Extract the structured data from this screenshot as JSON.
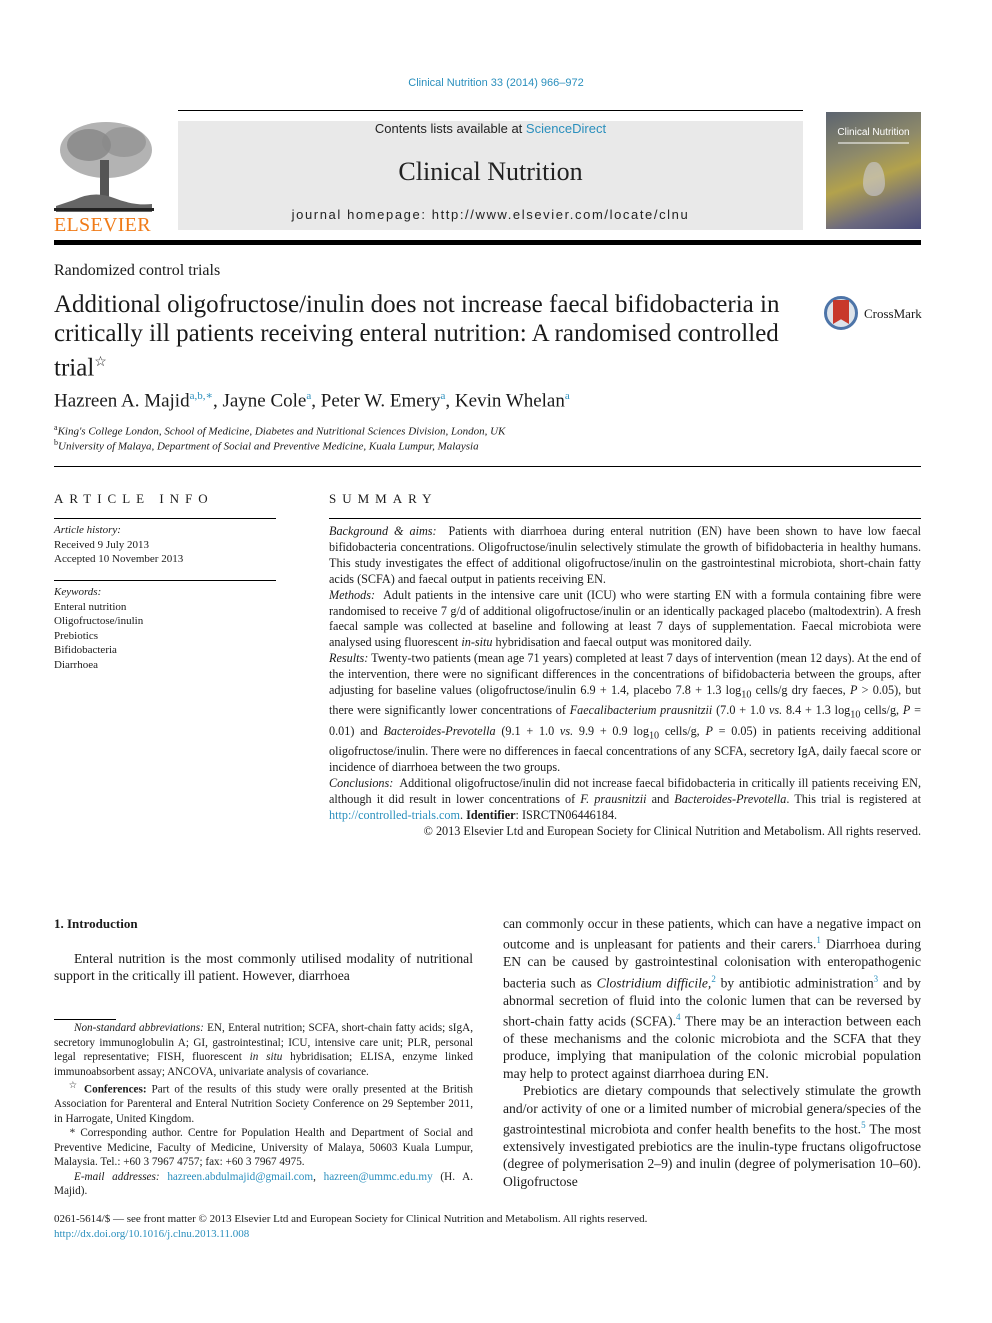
{
  "header": {
    "citation": "Clinical Nutrition 33 (2014) 966–972",
    "contents_prefix": "Contents lists available at ",
    "contents_link": "ScienceDirect",
    "journal_title": "Clinical Nutrition",
    "homepage": "journal homepage: http://www.elsevier.com/locate/clnu",
    "publisher": "ELSEVIER",
    "cover_title": "Clinical Nutrition",
    "crossmark": "CrossMark"
  },
  "article": {
    "category": "Randomized control trials",
    "title": "Additional oligofructose/inulin does not increase faecal bifidobacteria in critically ill patients receiving enteral nutrition: A randomised controlled trial",
    "title_mark": "☆",
    "authors": [
      {
        "name": "Hazreen A. Majid",
        "sup": "a,b,∗",
        "sep": ", "
      },
      {
        "name": "Jayne Cole",
        "sup": "a",
        "sep": ", "
      },
      {
        "name": "Peter W. Emery",
        "sup": "a",
        "sep": ", "
      },
      {
        "name": "Kevin Whelan",
        "sup": "a",
        "sep": ""
      }
    ],
    "affiliations": [
      {
        "mark": "a",
        "text": "King's College London, School of Medicine, Diabetes and Nutritional Sciences Division, London, UK"
      },
      {
        "mark": "b",
        "text": "University of Malaya, Department of Social and Preventive Medicine, Kuala Lumpur, Malaysia"
      }
    ]
  },
  "article_info": {
    "heading": "ARTICLE INFO",
    "history_label": "Article history:",
    "received": "Received 9 July 2013",
    "accepted": "Accepted 10 November 2013",
    "keywords_label": "Keywords:",
    "keywords": [
      "Enteral nutrition",
      "Oligofructose/inulin",
      "Prebiotics",
      "Bifidobacteria",
      "Diarrhoea"
    ]
  },
  "summary": {
    "heading": "SUMMARY",
    "background_label": "Background & aims:",
    "background": "Patients with diarrhoea during enteral nutrition (EN) have been shown to have low faecal bifidobacteria concentrations. Oligofructose/inulin selectively stimulate the growth of bifidobacteria in healthy humans. This study investigates the effect of additional oligofructose/inulin on the gastrointestinal microbiota, short-chain fatty acids (SCFA) and faecal output in patients receiving EN.",
    "methods_label": "Methods:",
    "methods_1": "Adult patients in the intensive care unit (ICU) who were starting EN with a formula containing fibre were randomised to receive 7 g/d of additional oligofructose/inulin or an identically packaged placebo (maltodextrin). A fresh faecal sample was collected at baseline and following at least 7 days of supplementation. Faecal microbiota were analysed using fluorescent ",
    "methods_it": "in-situ",
    "methods_2": " hybridisation and faecal output was monitored daily.",
    "results_label": "Results:",
    "results_1": "Twenty-two patients (mean age 71 years) completed at least 7 days of intervention (mean 12 days). At the end of the intervention, there were no significant differences in the concentrations of bifidobacteria between the groups, after adjusting for baseline values (oligofructose/inulin 6.9 + 1.4, placebo 7.8 + 1.3 log",
    "results_2": " cells/g dry faeces, ",
    "results_3": " > 0.05), but there were significantly lower concentrations of ",
    "results_fp": "Faecalibacterium prausnitzii",
    "results_4": " (7.0 + 1.0 ",
    "results_5": " 8.4 + 1.3 log",
    "results_6": " cells/g, ",
    "results_7": " = 0.01) and ",
    "results_bp": "Bacteroides-Prevotella",
    "results_8": " (9.1 + 1.0 ",
    "results_9": " 9.9 + 0.9 log",
    "results_10": " cells/g, ",
    "results_11": " = 0.05) in patients receiving additional oligofructose/inulin. There were no differences in faecal concentrations of any SCFA, secretory IgA, daily faecal score or incidence of diarrhoea between the two groups.",
    "vs": "vs.",
    "p": "P",
    "sub10": "10",
    "conclusions_label": "Conclusions:",
    "conclusions_1": "Additional oligofructose/inulin did not increase faecal bifidobacteria in critically ill patients receiving EN, although it did result in lower concentrations of ",
    "conclusions_fp": "F. prausnitzii",
    "conclusions_and": " and ",
    "conclusions_bp": "Bacteroides-Prevotella",
    "conclusions_2": ". This trial is registered at ",
    "trial_link": "http://controlled-trials.com",
    "identifier_label": "Identifier",
    "identifier": ": ISRCTN06446184.",
    "copyright": "© 2013 Elsevier Ltd and European Society for Clinical Nutrition and Metabolism. All rights reserved."
  },
  "introduction": {
    "heading": "1.  Introduction",
    "left_para": "Enteral nutrition is the most commonly utilised modality of nutritional support in the critically ill patient. However, diarrhoea",
    "right_1": "can commonly occur in these patients, which can have a negative impact on outcome and is unpleasant for patients and their carers.",
    "ref1": "1",
    "right_2": " Diarrhoea during EN can be caused by gastrointestinal colonisation with enteropathogenic bacteria such as ",
    "right_cd": "Clostridium difficile,",
    "ref2": "2",
    "right_3": " by antibiotic administration",
    "ref3": "3",
    "right_4": " and by abnormal secretion of fluid into the colonic lumen that can be reversed by short-chain fatty acids (SCFA).",
    "ref4": "4",
    "right_5": " There may be an interaction between each of these mechanisms and the colonic microbiota and the SCFA that they produce, implying that manipulation of the colonic microbial population may help to protect against diarrhoea during EN.",
    "prebiotics_1": "Prebiotics are dietary compounds that selectively stimulate the growth and/or activity of one or a limited number of microbial genera/species of the gastrointestinal microbiota and confer health benefits to the host.",
    "ref5": "5",
    "prebiotics_2": " The most extensively investigated prebiotics are the inulin-type fructans oligofructose (degree of polymerisation 2–9) and inulin (degree of polymerisation 10–60). Oligofructose"
  },
  "footnotes": {
    "abbr_label": "Non-standard abbreviations:",
    "abbr_1": " EN, Enteral nutrition; SCFA, short-chain fatty acids; sIgA, secretory immunoglobulin A; GI, gastrointestinal; ICU, intensive care unit; PLR, personal legal representative; FISH, fluorescent ",
    "abbr_it": "in situ",
    "abbr_2": " hybridisation; ELISA, enzyme linked immunoabsorbent assay; ANCOVA, univariate analysis of covariance.",
    "star": "☆",
    "conf_label": "Conferences:",
    "conf_text": " Part of the results of this study were orally presented at the British Association for Parenteral and Enteral Nutrition Society Conference on 29 September 2011, in Harrogate, United Kingdom.",
    "asterisk": "*",
    "corresp": " Corresponding author. Centre for Population Health and Department of Social and Preventive Medicine, Faculty of Medicine, University of Malaya, 50603 Kuala Lumpur, Malaysia. Tel.: +60 3 7967 4757; fax: +60 3 7967 4975.",
    "email_label": "E-mail addresses:",
    "email1": "hazreen.abdulmajid@gmail.com",
    "email_sep": ", ",
    "email2": "hazreen@ummc.edu.my",
    "email_tail": " (H. A. Majid)."
  },
  "bottom": {
    "front_matter": "0261-5614/$ — see front matter © 2013 Elsevier Ltd and European Society for Clinical Nutrition and Metabolism. All rights reserved.",
    "doi": "http://dx.doi.org/10.1016/j.clnu.2013.11.008"
  }
}
